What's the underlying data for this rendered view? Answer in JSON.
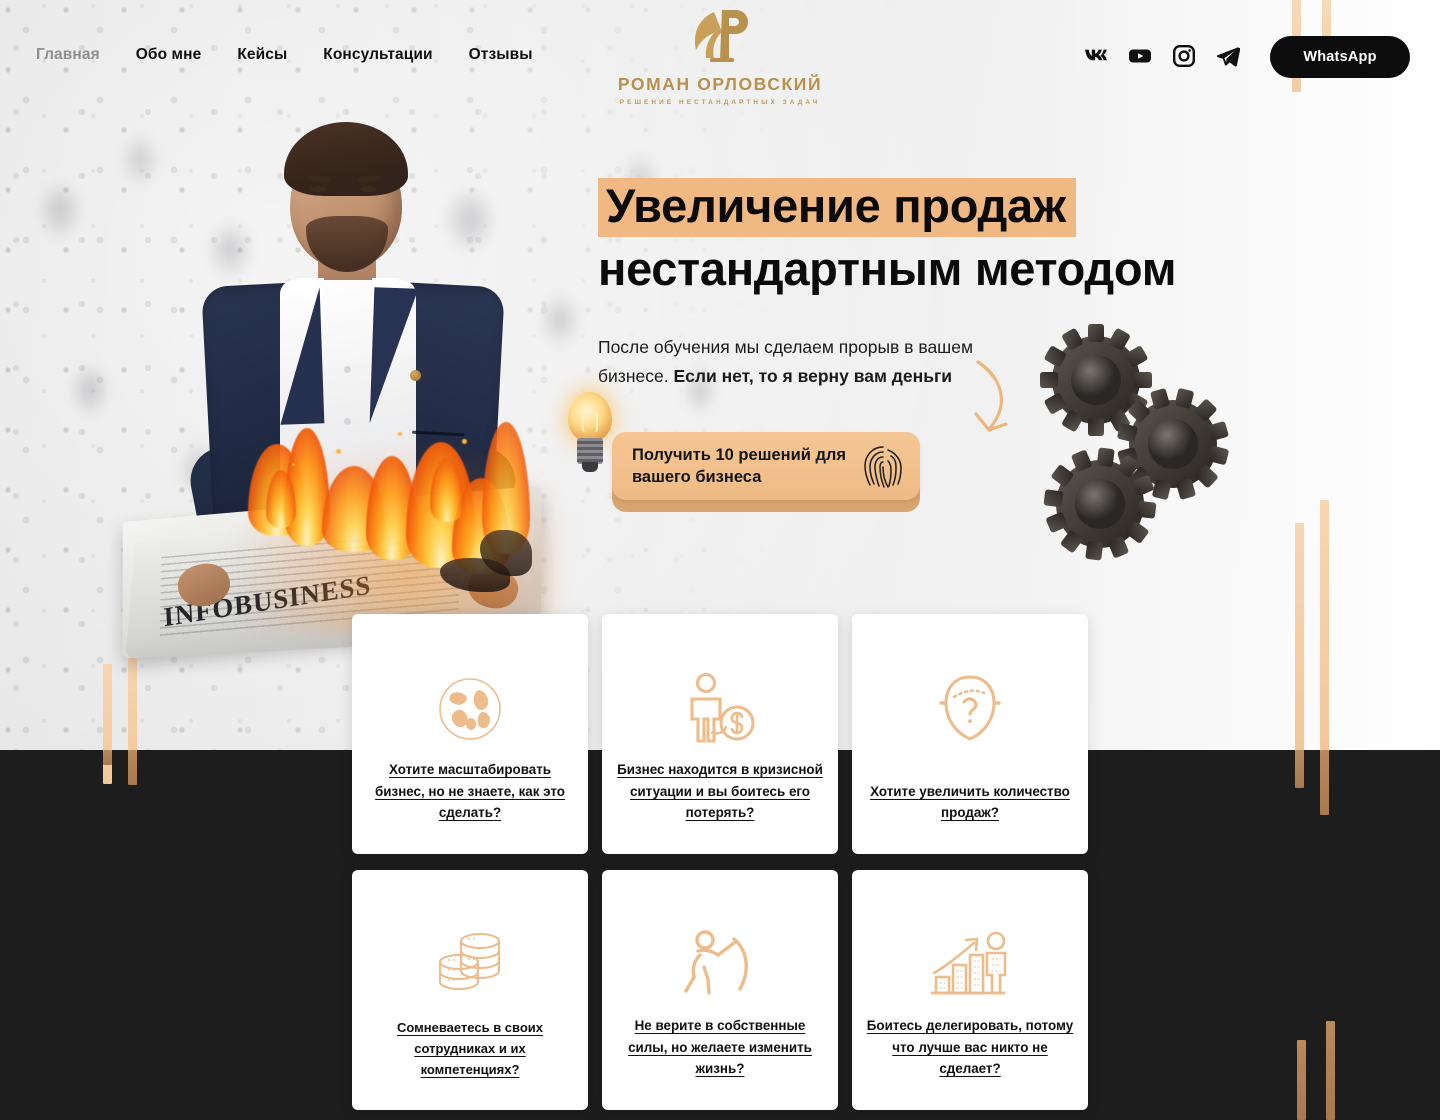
{
  "header": {
    "nav": [
      {
        "label": "Главная",
        "active": true
      },
      {
        "label": "Обо мне",
        "active": false
      },
      {
        "label": "Кейсы",
        "active": false
      },
      {
        "label": "Консультации",
        "active": false
      },
      {
        "label": "Отзывы",
        "active": false
      }
    ],
    "logo": {
      "name": "РОМАН ОРЛОВСКИЙ",
      "tagline": "РЕШЕНИЕ НЕСТАНДАРТНЫХ ЗАДАЧ",
      "monogram": "Р"
    },
    "socials": [
      {
        "name": "vk-icon",
        "label": "VK"
      },
      {
        "name": "youtube-icon",
        "label": "YouTube"
      },
      {
        "name": "instagram-icon",
        "label": "Instagram"
      },
      {
        "name": "telegram-icon",
        "label": "Telegram"
      }
    ],
    "whatsapp_label": "WhatsApp"
  },
  "hero": {
    "title_highlight": "Увеличение продаж",
    "title_rest": "нестандартным методом",
    "subtitle_normal": "После обучения мы сделаем прорыв в вашем бизнесе. ",
    "subtitle_bold": "Если нет, то я верну вам деньги",
    "cta_label": "Получить 10 решений для вашего бизнеса",
    "newspaper_title": "INFOBUSINESS"
  },
  "cards": [
    {
      "icon": "globe-icon",
      "text": "Хотите масштабировать бизнес, но не знаете, как это сделать?"
    },
    {
      "icon": "person-money-icon",
      "text": "Бизнес находится в кризисной ситуации и вы боитесь его потерять?"
    },
    {
      "icon": "head-question-icon",
      "text": "Хотите увеличить количество продаж?"
    },
    {
      "icon": "coins-stack-icon",
      "text": "Сомневаетесь в своих сотрудниках и их компетенциях?"
    },
    {
      "icon": "person-pushing-icon",
      "text": "Не верите в собственные силы, но желаете изменить жизнь?"
    },
    {
      "icon": "growth-chart-person-icon",
      "text": "Боитесь делегировать, потому что лучше вас никто не сделает?"
    }
  ],
  "colors": {
    "accent": "#f0b883",
    "gold": "#b8914f",
    "dark": "#1d1d1d",
    "bar_light": "#f2c79a",
    "bar_dark": "#b98a5d"
  }
}
